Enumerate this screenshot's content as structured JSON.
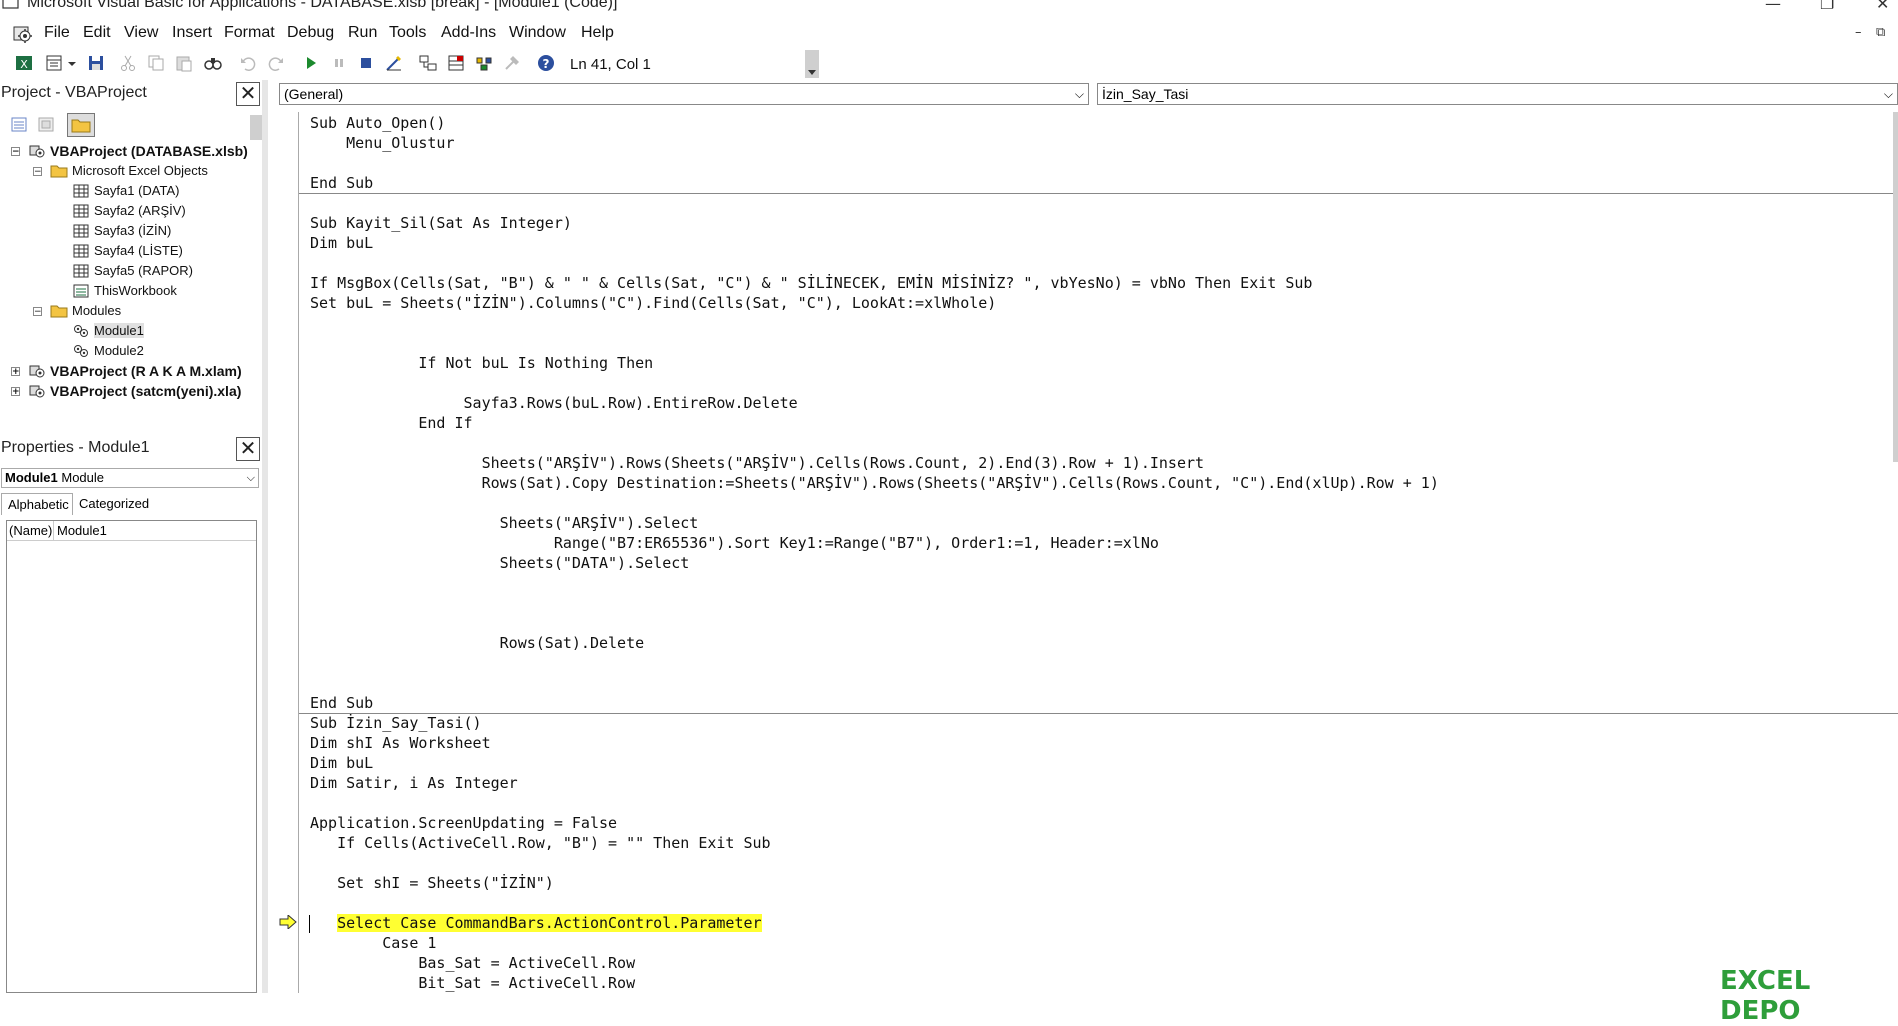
{
  "window": {
    "title": "Microsoft Visual Basic for Applications - DATABASE.xlsb [break] - [Module1 (Code)]",
    "controls": {
      "minimize": "—",
      "restore": "❐",
      "close": "✕"
    },
    "mdi_controls": {
      "minimize": "–",
      "restore": "⧉"
    }
  },
  "menubar": {
    "items": [
      {
        "id": "file",
        "label": "File"
      },
      {
        "id": "edit",
        "label": "Edit"
      },
      {
        "id": "view",
        "label": "View"
      },
      {
        "id": "insert",
        "label": "Insert"
      },
      {
        "id": "format",
        "label": "Format"
      },
      {
        "id": "debug",
        "label": "Debug"
      },
      {
        "id": "run",
        "label": "Run"
      },
      {
        "id": "tools",
        "label": "Tools"
      },
      {
        "id": "addins",
        "label": "Add-Ins"
      },
      {
        "id": "window",
        "label": "Window"
      },
      {
        "id": "help",
        "label": "Help"
      }
    ]
  },
  "toolbar": {
    "position": "Ln 41, Col 1",
    "buttons": [
      "view-excel-icon",
      "insert-module-icon",
      "dropdown-arrow-icon",
      "save-icon",
      "cut-icon",
      "copy-icon",
      "paste-icon",
      "find-icon",
      "undo-icon",
      "redo-icon",
      "run-icon",
      "break-icon",
      "reset-icon",
      "design-mode-icon",
      "project-explorer-icon",
      "properties-window-icon",
      "object-browser-icon",
      "toolbox-icon",
      "help-icon"
    ]
  },
  "project_pane": {
    "title": "Project - VBAProject",
    "close": "✕",
    "tree": [
      {
        "label": "VBAProject (DATABASE.xlsb)",
        "level": 0,
        "toggle": "−",
        "bold": true,
        "icon": "vba-project-icon"
      },
      {
        "label": "Microsoft Excel Objects",
        "level": 1,
        "toggle": "−",
        "bold": false,
        "icon": "folder-icon"
      },
      {
        "label": "Sayfa1 (DATA)",
        "level": 2,
        "toggle": "",
        "bold": false,
        "icon": "sheet-icon"
      },
      {
        "label": "Sayfa2 (ARŞİV)",
        "level": 2,
        "toggle": "",
        "bold": false,
        "icon": "sheet-icon"
      },
      {
        "label": "Sayfa3 (İZİN)",
        "level": 2,
        "toggle": "",
        "bold": false,
        "icon": "sheet-icon"
      },
      {
        "label": "Sayfa4 (LİSTE)",
        "level": 2,
        "toggle": "",
        "bold": false,
        "icon": "sheet-icon"
      },
      {
        "label": "Sayfa5 (RAPOR)",
        "level": 2,
        "toggle": "",
        "bold": false,
        "icon": "sheet-icon"
      },
      {
        "label": "ThisWorkbook",
        "level": 2,
        "toggle": "",
        "bold": false,
        "icon": "workbook-icon"
      },
      {
        "label": "Modules",
        "level": 1,
        "toggle": "−",
        "bold": false,
        "icon": "folder-icon"
      },
      {
        "label": "Module1",
        "level": 2,
        "toggle": "",
        "bold": false,
        "icon": "module-icon",
        "selected": true
      },
      {
        "label": "Module2",
        "level": 2,
        "toggle": "",
        "bold": false,
        "icon": "module-icon"
      },
      {
        "label": "VBAProject (R A K A M.xlam)",
        "level": 0,
        "toggle": "+",
        "bold": true,
        "icon": "vba-project-icon"
      },
      {
        "label": "VBAProject (satcm(yeni).xla)",
        "level": 0,
        "toggle": "+",
        "bold": true,
        "icon": "vba-project-icon"
      }
    ]
  },
  "properties_pane": {
    "title": "Properties - Module1",
    "close": "✕",
    "object_name": "Module1",
    "object_type": "Module",
    "tabs": [
      "Alphabetic",
      "Categorized"
    ],
    "rows": [
      {
        "name": "(Name)",
        "value": "Module1"
      }
    ]
  },
  "code_window": {
    "object_combo": "(General)",
    "proc_combo": "İzin_Say_Tasi",
    "chev": "⌵",
    "lines": [
      "Sub Auto_Open()",
      "    Menu_Olustur",
      "",
      "End Sub",
      "",
      "Sub Kayit_Sil(Sat As Integer)",
      "Dim buL",
      "",
      "If MsgBox(Cells(Sat, \"B\") & \" \" & Cells(Sat, \"C\") & \" SİLİNECEK, EMİN MİSİNİZ? \", vbYesNo) = vbNo Then Exit Sub",
      "Set buL = Sheets(\"İZİN\").Columns(\"C\").Find(Cells(Sat, \"C\"), LookAt:=xlWhole)",
      "",
      "",
      "            If Not buL Is Nothing Then",
      "",
      "                 Sayfa3.Rows(buL.Row).EntireRow.Delete",
      "            End If",
      "",
      "                   Sheets(\"ARŞİV\").Rows(Sheets(\"ARŞİV\").Cells(Rows.Count, 2).End(3).Row + 1).Insert",
      "                   Rows(Sat).Copy Destination:=Sheets(\"ARŞİV\").Rows(Sheets(\"ARŞİV\").Cells(Rows.Count, \"C\").End(xlUp).Row + 1)",
      "",
      "                     Sheets(\"ARŞİV\").Select",
      "                           Range(\"B7:ER65536\").Sort Key1:=Range(\"B7\"), Order1:=1, Header:=xlNo",
      "                     Sheets(\"DATA\").Select",
      "",
      "",
      "",
      "                     Rows(Sat).Delete",
      "",
      "",
      "End Sub",
      "Sub İzin_Say_Tasi()",
      "Dim shI As Worksheet",
      "Dim buL",
      "Dim Satir, i As Integer",
      "",
      "Application.ScreenUpdating = False",
      "   If Cells(ActiveCell.Row, \"B\") = \"\" Then Exit Sub",
      "",
      "   Set shI = Sheets(\"İZİN\")",
      "",
      "   Select Case CommandBars.ActionControl.Parameter",
      "        Case 1",
      "            Bas_Sat = ActiveCell.Row",
      "            Bit_Sat = ActiveCell.Row"
    ],
    "highlight_line": 40,
    "separator_after": [
      3,
      29
    ]
  },
  "watermark": "EXCEL DEPO"
}
